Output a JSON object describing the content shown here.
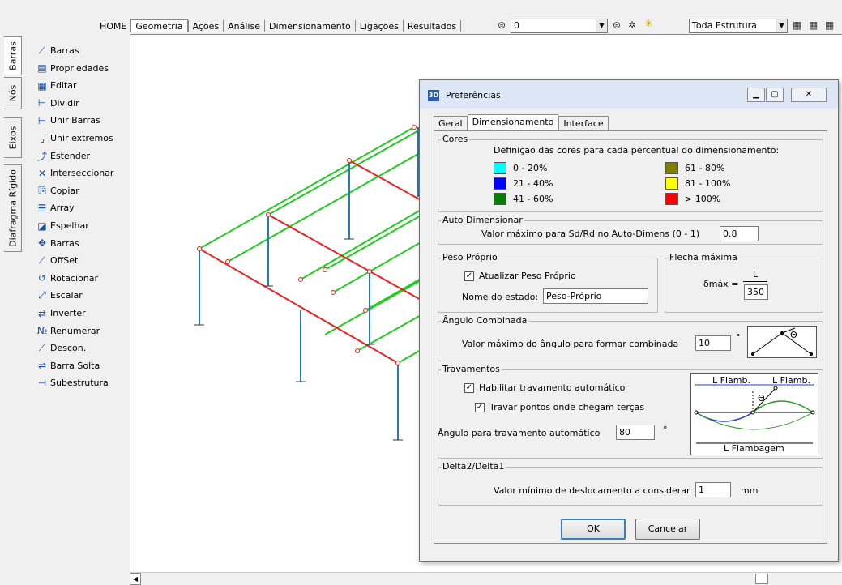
{
  "menu": {
    "items": [
      "HOME",
      "Geometria",
      "Ações",
      "Análise",
      "Dimensionamento",
      "Ligações",
      "Resultados"
    ],
    "active_index": 1,
    "layer_combo_value": "0",
    "structure_combo_value": "Toda Estrutura"
  },
  "side_tabs": [
    "Barras",
    "Nós",
    "Eixos",
    "Diafragma Rígido"
  ],
  "tools": [
    {
      "label": "Barras",
      "icon": "line-add-icon"
    },
    {
      "label": "Propriedades",
      "icon": "properties-icon"
    },
    {
      "label": "Editar",
      "icon": "table-edit-icon"
    },
    {
      "label": "Dividir",
      "icon": "divide-icon"
    },
    {
      "label": "Unir Barras",
      "icon": "join-bars-icon"
    },
    {
      "label": "Unir extremos",
      "icon": "join-ends-icon"
    },
    {
      "label": "Estender",
      "icon": "extend-icon"
    },
    {
      "label": "Interseccionar",
      "icon": "intersect-icon"
    },
    {
      "label": "Copiar",
      "icon": "copy-icon"
    },
    {
      "label": "Array",
      "icon": "array-icon"
    },
    {
      "label": "Espelhar",
      "icon": "mirror-icon"
    },
    {
      "label": "Barras",
      "icon": "move-bars-icon"
    },
    {
      "label": "OffSet",
      "icon": "offset-icon"
    },
    {
      "label": "Rotacionar",
      "icon": "rotate-icon"
    },
    {
      "label": "Escalar",
      "icon": "scale-icon"
    },
    {
      "label": "Inverter",
      "icon": "invert-icon"
    },
    {
      "label": "Renumerar",
      "icon": "renumber-icon"
    },
    {
      "label": "Descon.",
      "icon": "disconnect-icon"
    },
    {
      "label": "Barra Solta",
      "icon": "loose-bar-icon"
    },
    {
      "label": "Subestrutura",
      "icon": "substructure-icon"
    }
  ],
  "dialog": {
    "title": "Preferências",
    "title_badge": "3D",
    "tabs": [
      "Geral",
      "Dimensionamento",
      "Interface"
    ],
    "cores": {
      "label": "Cores",
      "description": "Definição das cores para cada percentual do dimensionamento:",
      "items": [
        {
          "label": "0 - 20%",
          "color": "#00ffff"
        },
        {
          "label": "21 - 40%",
          "color": "#0000ff"
        },
        {
          "label": "41 - 60%",
          "color": "#008000"
        },
        {
          "label": "61 - 80%",
          "color": "#808000"
        },
        {
          "label": "81 - 100%",
          "color": "#ffff00"
        },
        {
          "label": "> 100%",
          "color": "#ff0000"
        }
      ]
    },
    "auto": {
      "label": "Auto Dimensionar",
      "field_label": "Valor máximo para Sd/Rd no Auto-Dimens (0 - 1)",
      "value": "0.8"
    },
    "peso": {
      "label": "Peso Próprio",
      "checkbox_label": "Atualizar Peso Próprio",
      "name_label": "Nome do estado:",
      "name_value": "Peso-Próprio"
    },
    "flecha": {
      "label": "Flecha máxima",
      "delta_label": "δmáx =",
      "numerator": "L",
      "denominator": "350"
    },
    "angulo": {
      "label": "Ângulo Combinada",
      "field_label": "Valor máximo do ângulo para formar combinada",
      "value": "10",
      "unit": "°",
      "theta": "Θ"
    },
    "travamentos": {
      "label": "Travamentos",
      "check1_label": "Habilitar travamento automático",
      "check2_label": "Travar pontos onde chegam terças",
      "angle_label": "Ângulo para travamento automático",
      "angle_value": "80",
      "unit": "°",
      "fig_top_left": "L Flamb.",
      "fig_top_right": "L Flamb.",
      "fig_bottom": "L Flambagem",
      "theta": "Θ"
    },
    "delta": {
      "label": "Delta2/Delta1",
      "field_label": "Valor mínimo de deslocamento a considerar",
      "value": "1",
      "unit": "mm"
    },
    "ok_label": "OK",
    "cancel_label": "Cancelar"
  }
}
